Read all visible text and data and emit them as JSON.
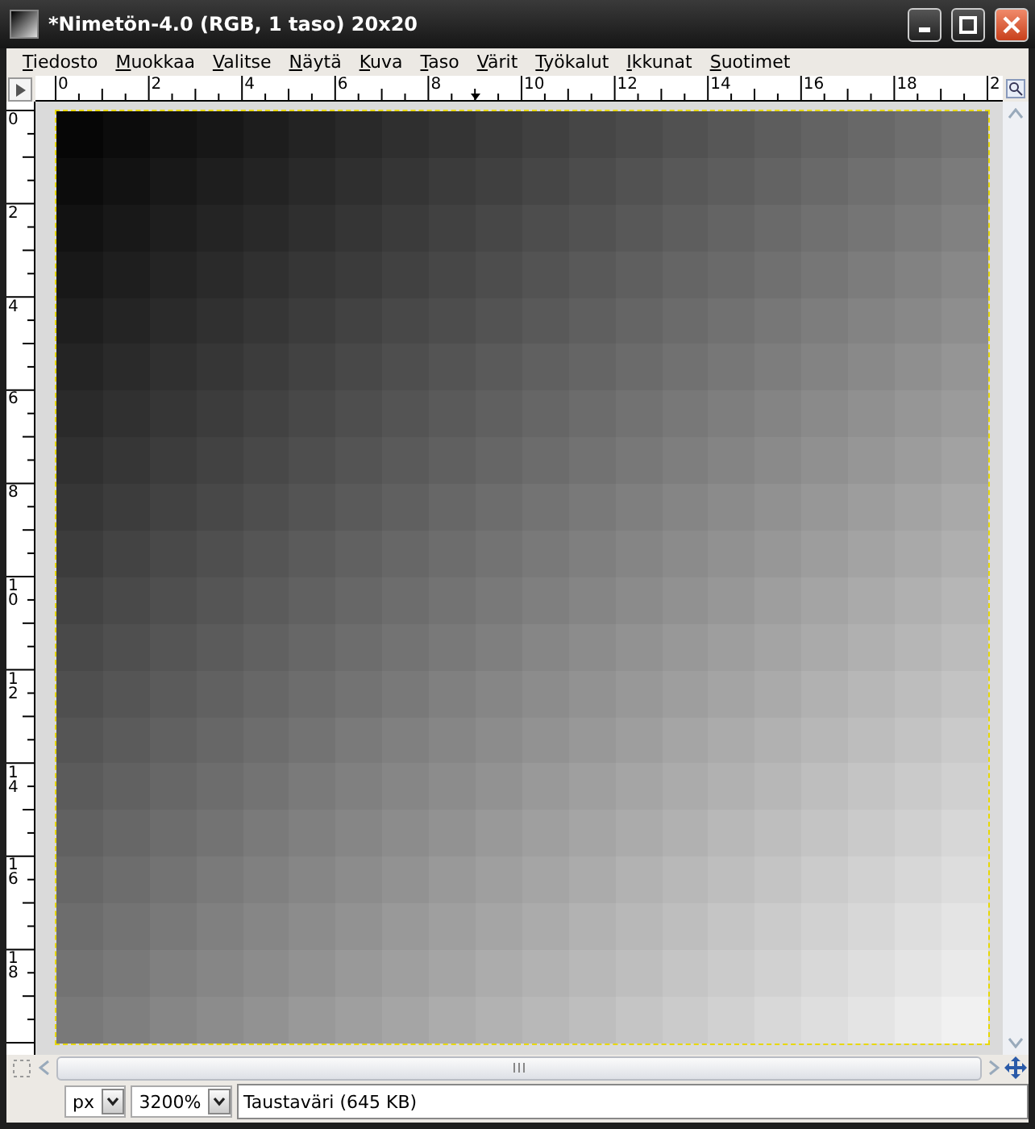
{
  "window": {
    "title": "*Nimetön-4.0 (RGB, 1 taso) 20x20"
  },
  "menu": [
    "Tiedosto",
    "Muokkaa",
    "Valitse",
    "Näytä",
    "Kuva",
    "Taso",
    "Värit",
    "Työkalut",
    "Ikkunat",
    "Suotimet"
  ],
  "rulers": {
    "horizontal": [
      "0",
      "2",
      "4",
      "6",
      "8",
      "10",
      "12",
      "14",
      "16",
      "18",
      "2"
    ],
    "vertical": [
      "0",
      "2",
      "4",
      "6",
      "8",
      "10",
      "12",
      "14",
      "16",
      "18"
    ]
  },
  "status_bar": {
    "unit": "px",
    "zoom": "3200%",
    "message": "Taustaväri (645 KB)"
  }
}
